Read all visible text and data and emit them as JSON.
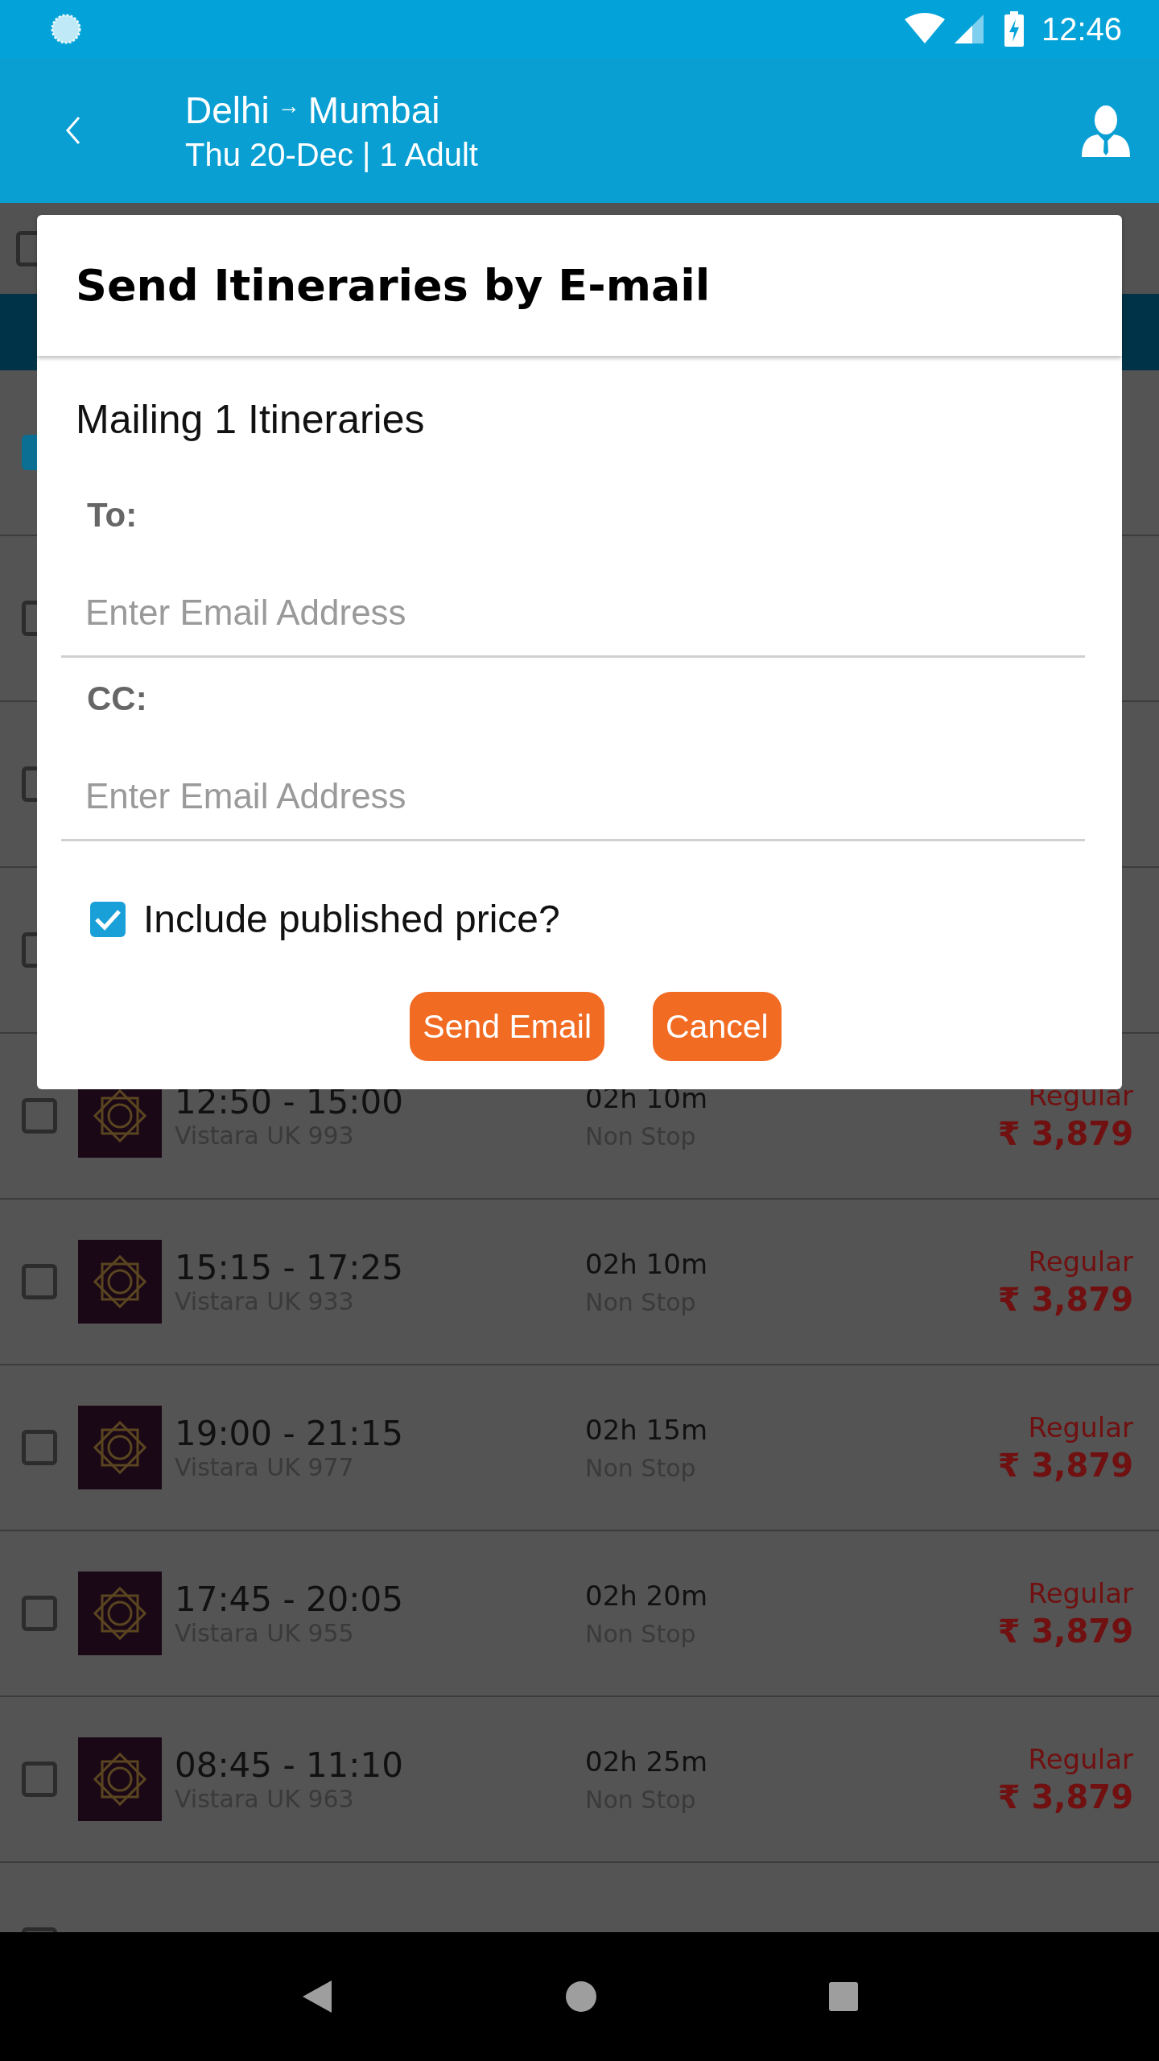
{
  "status_bar": {
    "time": "12:46"
  },
  "header": {
    "origin": "Delhi",
    "arrow": "→",
    "destination": "Mumbai",
    "subtitle": "Thu 20-Dec | 1 Adult"
  },
  "select_all": {
    "checked": false
  },
  "flights": [
    {
      "checked": true
    },
    {
      "checked": false
    },
    {
      "checked": false
    },
    {
      "checked": false
    },
    {
      "checked": false,
      "times": "12:50 - 15:00",
      "flight": "Vistara UK 993",
      "duration": "02h 10m",
      "stops": "Non Stop",
      "fare": "Regular",
      "price": "₹ 3,879"
    },
    {
      "checked": false,
      "times": "15:15 - 17:25",
      "flight": "Vistara UK 933",
      "duration": "02h 10m",
      "stops": "Non Stop",
      "fare": "Regular",
      "price": "₹ 3,879"
    },
    {
      "checked": false,
      "times": "19:00 - 21:15",
      "flight": "Vistara UK 977",
      "duration": "02h 15m",
      "stops": "Non Stop",
      "fare": "Regular",
      "price": "₹ 3,879"
    },
    {
      "checked": false,
      "times": "17:45 - 20:05",
      "flight": "Vistara UK 955",
      "duration": "02h 20m",
      "stops": "Non Stop",
      "fare": "Regular",
      "price": "₹ 3,879"
    },
    {
      "checked": false,
      "times": "08:45 - 11:10",
      "flight": "Vistara UK 963",
      "duration": "02h 25m",
      "stops": "Non Stop",
      "fare": "Regular",
      "price": "₹ 3,879"
    },
    {
      "checked": false
    }
  ],
  "dialog": {
    "title": "Send Itineraries by E-mail",
    "summary": "Mailing 1 Itineraries",
    "fields": [
      {
        "label": "To:",
        "placeholder": "Enter Email Address"
      },
      {
        "label": "CC:",
        "placeholder": "Enter Email Address"
      }
    ],
    "include_price": {
      "label": "Include published price?",
      "checked": true
    },
    "buttons": [
      "Send Email",
      "Cancel"
    ]
  }
}
